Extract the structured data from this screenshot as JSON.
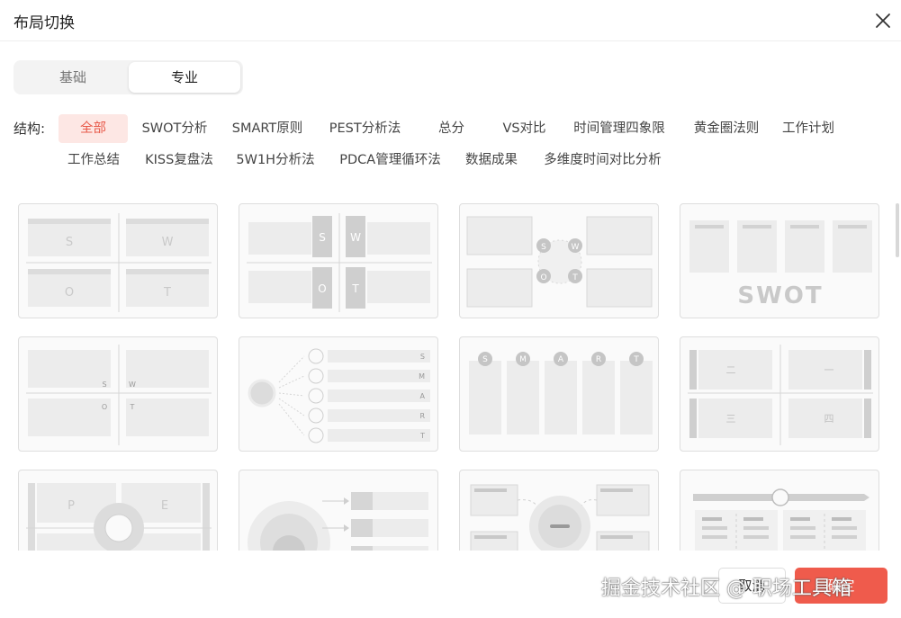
{
  "dialog": {
    "title": "布局切换"
  },
  "tabs": [
    {
      "label": "基础"
    },
    {
      "label": "专业"
    }
  ],
  "filter": {
    "label": "结构:",
    "chips": [
      "全部",
      "SWOT分析",
      "SMART原则",
      "PEST分析法",
      "总分",
      "VS对比",
      "时间管理四象限",
      "黄金圈法则",
      "工作计划",
      "工作总结",
      "KISS复盘法",
      "5W1H分析法",
      "PDCA管理循环法",
      "数据成果",
      "多维度时间对比分析"
    ],
    "active_index": 0
  },
  "cards": {
    "swot": {
      "s": "S",
      "w": "W",
      "o": "O",
      "t": "T",
      "word": "SWOT"
    },
    "smart": [
      "S",
      "M",
      "A",
      "R",
      "T"
    ],
    "pest": {
      "p": "P",
      "e": "E"
    },
    "quadrant_labels": [
      "二",
      "一",
      "三",
      "四"
    ]
  },
  "footer": {
    "cancel": "取消",
    "confirm": "确定"
  },
  "watermark": "掘金技术社区 @ 职场工具箱",
  "colors": {
    "accent": "#ef5b4c",
    "active_chip_bg": "#fde7e4",
    "active_chip_text": "#e85a4a"
  }
}
